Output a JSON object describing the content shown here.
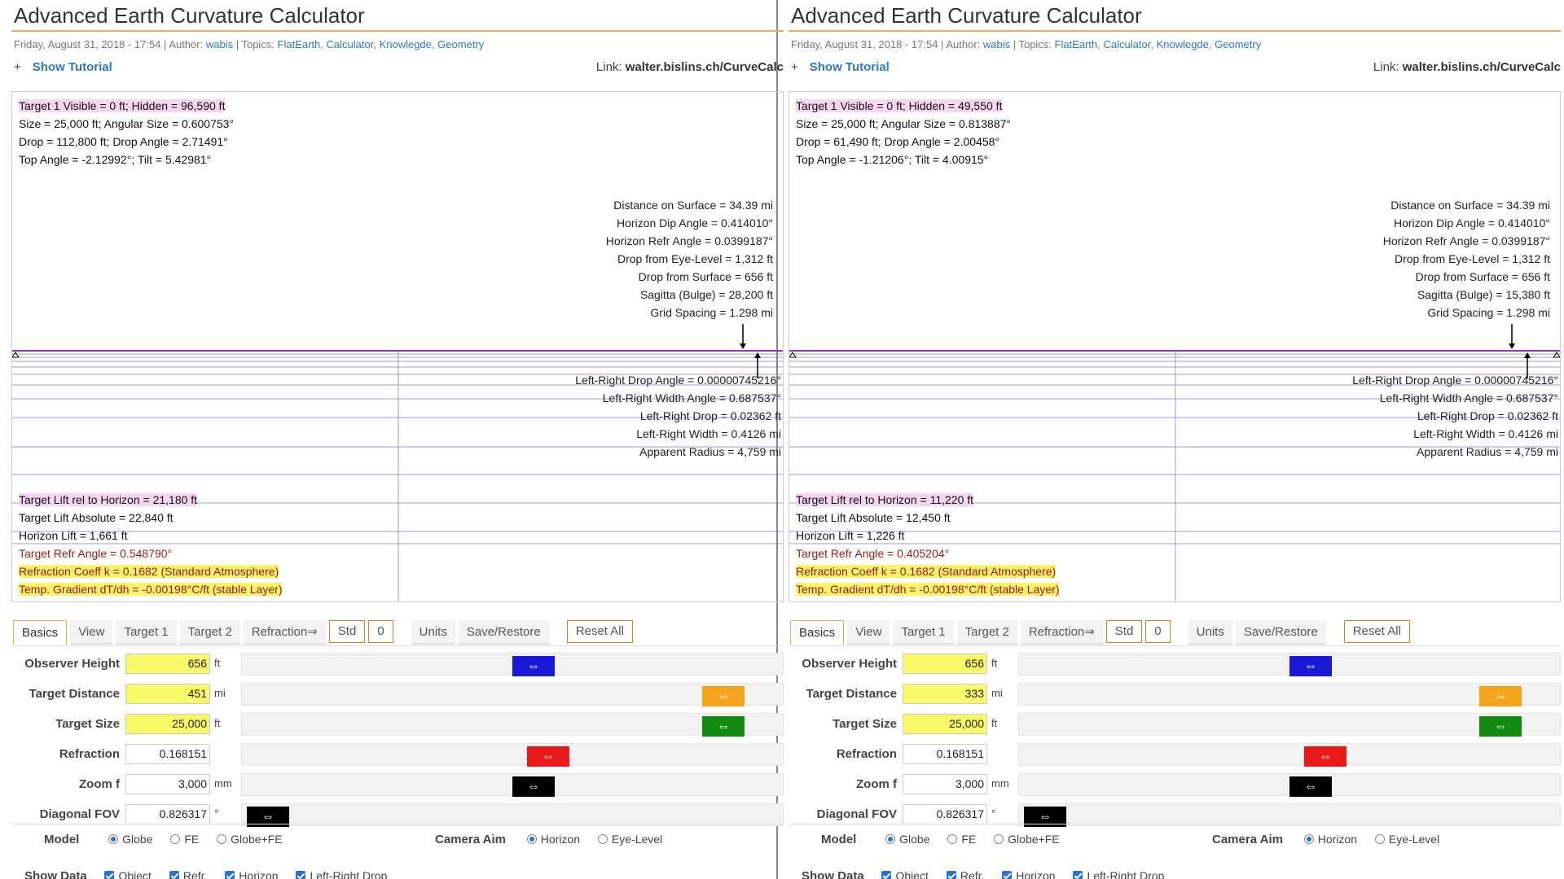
{
  "colors": {
    "observer": "#1a1ad6",
    "distance": "#f5a41d",
    "size": "#128a12",
    "refraction": "#e81a1a",
    "zoom": "#000000",
    "fov": "#000000",
    "grid_line": "#7b7bd6",
    "horizon_line": "#9b30c8"
  },
  "panels": [
    {
      "title": "Advanced Earth Curvature Calculator",
      "meta": {
        "date": "Friday, August 31, 2018 - 17:54 | Author: ",
        "author": "wabis",
        "topics_prefix": " | Topics: ",
        "topics": [
          "FlatEarth",
          "Calculator",
          "Knowlegde",
          "Geometry"
        ]
      },
      "tutorial": {
        "plus": "+",
        "label": "Show Tutorial"
      },
      "link": {
        "prefix": "Link: ",
        "url": "walter.bislins.ch/CurveCalc"
      },
      "target_info": [
        "Target 1 Visible = 0 ft; Hidden = 96,590 ft",
        "Size  = 25,000 ft; Angular Size = 0.600753°",
        "Drop = 112,800 ft; Drop Angle = 2.71491°",
        "Top Angle = -2.12992°; Tilt = 5.42981°"
      ],
      "stats_right": [
        "Distance on Surface = 34.39 mi",
        "Horizon Dip Angle = 0.414010°",
        "Horizon Refr Angle = 0.0399187°",
        "Drop from Eye-Level = 1,312 ft",
        "Drop from Surface = 656 ft",
        "Sagitta (Bulge) = 28,200 ft",
        "Grid Spacing = 1.298 mi"
      ],
      "stats_lr": [
        "Left-Right Drop Angle = 0.00000745216°",
        "Left-Right Width Angle = 0.687537°",
        "Left-Right Drop = 0.02362 ft",
        "Left-Right Width = 0.4126 mi",
        "Apparent Radius = 4,759 mi"
      ],
      "lift": {
        "target_lift_rel": "Target Lift rel to Horizon = 21,180 ft",
        "target_lift_abs": "Target Lift Absolute = 22,840 ft",
        "horizon_lift": "Horizon Lift = 1,661 ft",
        "target_refr": "Target Refr Angle = 0.548790°",
        "refr_coeff": "Refraction Coeff k = 0.1682 (Standard Atmosphere)",
        "temp_gradient": "Temp. Gradient dT/dh = -0.00198°C/ft (stable Layer)"
      },
      "tabs": [
        "Basics",
        "View",
        "Target 1",
        "Target 2",
        "Refraction⇒",
        "Std",
        "0",
        "Units",
        "Save/Restore",
        "Reset All"
      ],
      "inputs": [
        {
          "label": "Observer Height",
          "value": "656",
          "unit": "ft",
          "handle": "⇔",
          "slider": 0.54
        },
        {
          "label": "Target Distance",
          "value": "451",
          "unit": "mi",
          "handle": "⇔",
          "slider": 0.92
        },
        {
          "label": "Target Size",
          "value": "25,000",
          "unit": "ft",
          "handle": "⇔",
          "slider": 0.92
        },
        {
          "label": "Refraction",
          "value": "0.168151",
          "unit": "",
          "handle": "⇔",
          "slider": 0.57
        },
        {
          "label": "Zoom f",
          "value": "3,000",
          "unit": "mm",
          "handle": "⇔",
          "slider": 0.54
        },
        {
          "label": "Diagonal FOV",
          "value": "0.826317",
          "unit": "°",
          "handle": "⇔",
          "slider": 0.01
        }
      ],
      "model": {
        "label": "Model",
        "options": [
          "Globe",
          "FE",
          "Globe+FE"
        ],
        "selected": "Globe"
      },
      "camera_aim": {
        "label": "Camera Aim",
        "options": [
          "Horizon",
          "Eye-Level"
        ],
        "selected": "Horizon"
      },
      "show_data": {
        "label": "Show Data",
        "options": [
          "Object",
          "Refr.",
          "Horizon",
          "Left-Right Drop"
        ]
      }
    },
    {
      "title": "Advanced Earth Curvature Calculator",
      "meta": {
        "date": "Friday, August 31, 2018 - 17:54 | Author: ",
        "author": "wabis",
        "topics_prefix": " | Topics: ",
        "topics": [
          "FlatEarth",
          "Calculator",
          "Knowlegde",
          "Geometry"
        ]
      },
      "tutorial": {
        "plus": "+",
        "label": "Show Tutorial"
      },
      "link": {
        "prefix": "Link: ",
        "url": "walter.bislins.ch/CurveCalc"
      },
      "target_info": [
        "Target 1 Visible = 0 ft; Hidden = 49,550 ft",
        "Size  = 25,000 ft; Angular Size = 0.813887°",
        "Drop = 61,490 ft; Drop Angle = 2.00458°",
        "Top Angle = -1.21206°; Tilt = 4.00915°"
      ],
      "stats_right": [
        "Distance on Surface = 34.39 mi",
        "Horizon Dip Angle = 0.414010°",
        "Horizon Refr Angle = 0.0399187°",
        "Drop from Eye-Level = 1,312 ft",
        "Drop from Surface = 656 ft",
        "Sagitta (Bulge) = 15,380 ft",
        "Grid Spacing = 1.298 mi"
      ],
      "stats_lr": [
        "Left-Right Drop Angle = 0.00000745216°",
        "Left-Right Width Angle = 0.687537°",
        "Left-Right Drop = 0.02362 ft",
        "Left-Right Width = 0.4126 mi",
        "Apparent Radius = 4,759 mi"
      ],
      "lift": {
        "target_lift_rel": "Target Lift rel to Horizon = 11,220 ft",
        "target_lift_abs": "Target Lift Absolute = 12,450 ft",
        "horizon_lift": "Horizon Lift = 1,226 ft",
        "target_refr": "Target Refr Angle = 0.405204°",
        "refr_coeff": "Refraction Coeff k = 0.1682 (Standard Atmosphere)",
        "temp_gradient": "Temp. Gradient dT/dh = -0.00198°C/ft (stable Layer)"
      },
      "tabs": [
        "Basics",
        "View",
        "Target 1",
        "Target 2",
        "Refraction⇒",
        "Std",
        "0",
        "Units",
        "Save/Restore",
        "Reset All"
      ],
      "inputs": [
        {
          "label": "Observer Height",
          "value": "656",
          "unit": "ft",
          "handle": "⇔",
          "slider": 0.54
        },
        {
          "label": "Target Distance",
          "value": "333",
          "unit": "mi",
          "handle": "⇔",
          "slider": 0.92
        },
        {
          "label": "Target Size",
          "value": "25,000",
          "unit": "ft",
          "handle": "⇔",
          "slider": 0.92
        },
        {
          "label": "Refraction",
          "value": "0.168151",
          "unit": "",
          "handle": "⇔",
          "slider": 0.57
        },
        {
          "label": "Zoom f",
          "value": "3,000",
          "unit": "mm",
          "handle": "⇔",
          "slider": 0.54
        },
        {
          "label": "Diagonal FOV",
          "value": "0.826317",
          "unit": "°",
          "handle": "⇔",
          "slider": 0.01
        }
      ],
      "model": {
        "label": "Model",
        "options": [
          "Globe",
          "FE",
          "Globe+FE"
        ],
        "selected": "Globe"
      },
      "camera_aim": {
        "label": "Camera Aim",
        "options": [
          "Horizon",
          "Eye-Level"
        ],
        "selected": "Horizon"
      },
      "show_data": {
        "label": "Show Data",
        "options": [
          "Object",
          "Refr.",
          "Horizon",
          "Left-Right Drop"
        ]
      }
    }
  ]
}
